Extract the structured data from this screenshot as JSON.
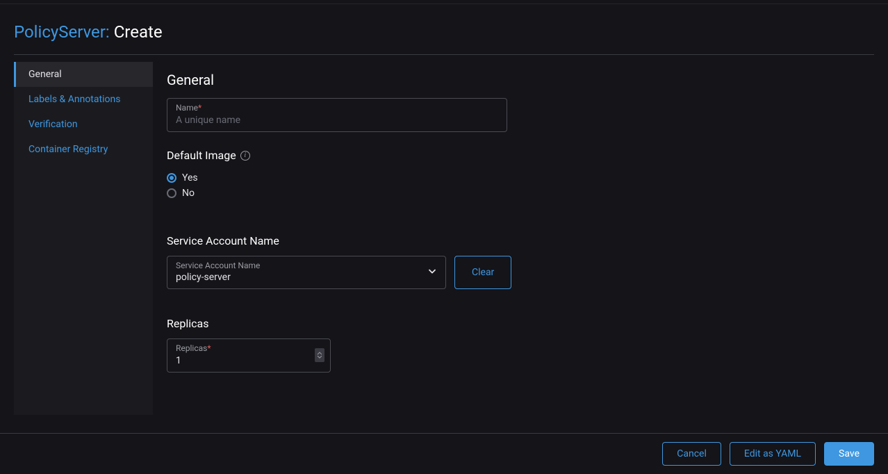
{
  "header": {
    "prefix": "PolicyServer: ",
    "suffix": "Create"
  },
  "sidebar": {
    "items": [
      {
        "label": "General",
        "active": true
      },
      {
        "label": "Labels & Annotations",
        "active": false
      },
      {
        "label": "Verification",
        "active": false
      },
      {
        "label": "Container Registry",
        "active": false
      }
    ]
  },
  "main": {
    "section_title": "General",
    "name_field": {
      "label": "Name",
      "placeholder": "A unique name",
      "value": ""
    },
    "default_image": {
      "title": "Default Image",
      "options": [
        {
          "label": "Yes",
          "selected": true
        },
        {
          "label": "No",
          "selected": false
        }
      ]
    },
    "service_account": {
      "title": "Service Account Name",
      "label": "Service Account Name",
      "value": "policy-server",
      "clear_label": "Clear"
    },
    "replicas": {
      "title": "Replicas",
      "label": "Replicas",
      "value": "1"
    }
  },
  "footer": {
    "cancel": "Cancel",
    "edit_yaml": "Edit as YAML",
    "save": "Save"
  }
}
